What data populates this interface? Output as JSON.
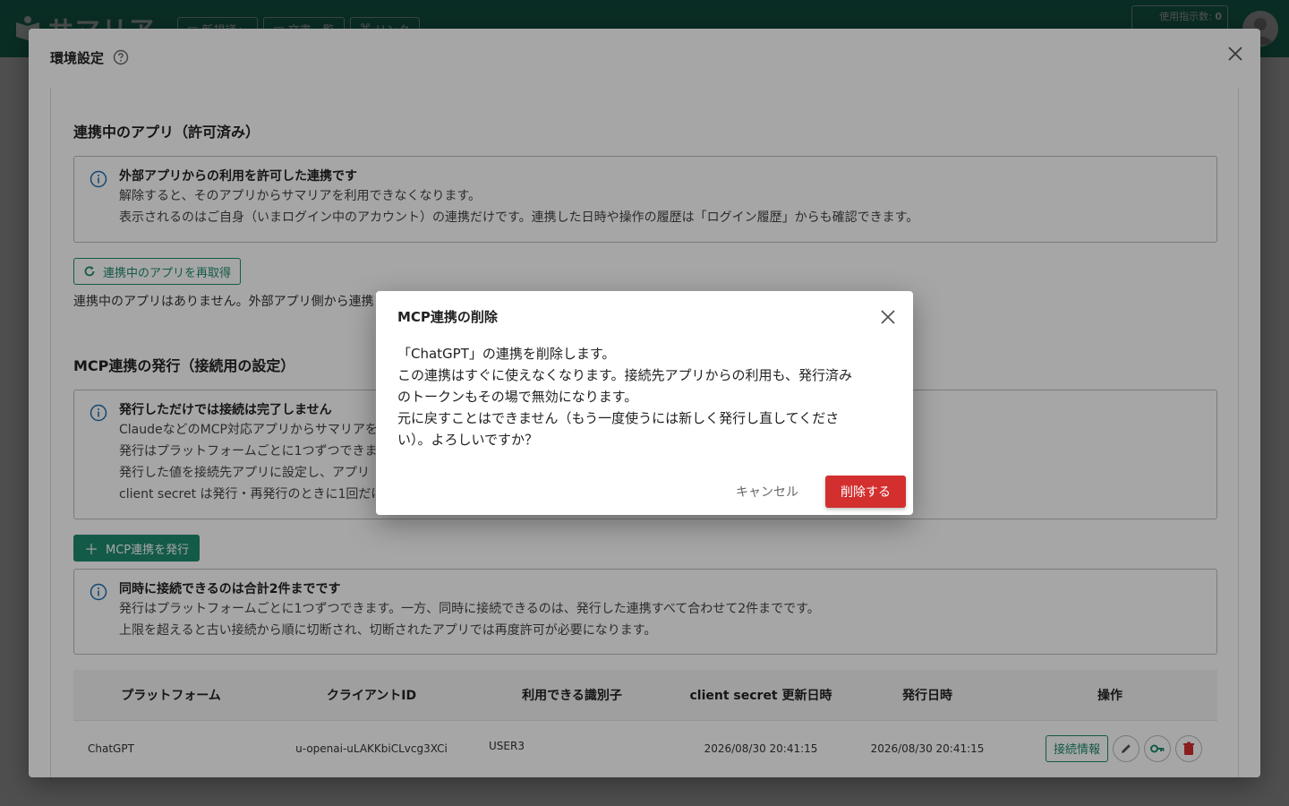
{
  "app": {
    "brand": "サマリア",
    "nav": [
      "新規議」",
      "文書一覧",
      "リンク"
    ],
    "usage_label": "使用指示数:",
    "usage_value": "0"
  },
  "settings": {
    "title": "環境設定",
    "linked_apps": {
      "title": "連携中のアプリ（許可済み）",
      "info_head": "外部アプリからの利用を許可した連携です",
      "info_lines": [
        "解除すると、そのアプリからサマリアを利用できなくなります。",
        "表示されるのはご自身（いまログイン中のアカウント）の連携だけです。連携した日時や操作の履歴は「ログイン履歴」からも確認できます。"
      ],
      "refresh_button": "連携中のアプリを再取得",
      "empty_text": "連携中のアプリはありません。外部アプリ側から連携"
    },
    "mcp": {
      "title": "MCP連携の発行（接続用の設定）",
      "info_head": "発行しただけでは接続は完了しません",
      "info_lines": [
        "ClaudeなどのMCP対応アプリからサマリアを",
        "発行はプラットフォームごとに1つずつできま",
        "発行した値を接続先アプリに設定し、アプリ",
        "client secret は発行・再発行のときに1回だけ"
      ],
      "issue_button": "MCP連携を発行",
      "limit_head": "同時に接続できるのは合計2件までです",
      "limit_lines": [
        "発行はプラットフォームごとに1つずつできます。一方、同時に接続できるのは、発行した連携すべて合わせて2件までです。",
        "上限を超えると古い接続から順に切断され、切断されたアプリでは再度許可が必要になります。"
      ]
    },
    "table": {
      "headers": [
        "プラットフォーム",
        "クライアントID",
        "利用できる識別子",
        "client secret 更新日時",
        "発行日時",
        "操作"
      ],
      "rows": [
        {
          "platform": "ChatGPT",
          "client_id": "u-openai-uLAKKbiCLvcg3XCi",
          "identifier": "USER3",
          "secret_updated": "2026/08/30 20:41:15",
          "issued": "2026/08/30 20:41:15",
          "info_button": "接続情報"
        }
      ]
    }
  },
  "confirm": {
    "title": "MCP連携の削除",
    "lines": [
      "「ChatGPT」の連携を削除します。",
      "この連携はすぐに使えなくなります。接続先アプリからの利用も、発行済み",
      "のトークンもその場で無効になります。",
      "元に戻すことはできません（もう一度使うには新しく発行し直してくださ",
      "い）。よろしいですか？"
    ],
    "cancel": "キャンセル",
    "delete": "削除する"
  },
  "colors": {
    "brand": "#1f8a70",
    "danger": "#d32f2f"
  }
}
